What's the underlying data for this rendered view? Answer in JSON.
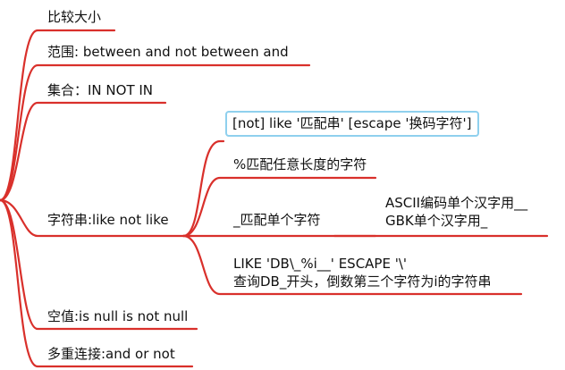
{
  "mindmap": {
    "branches": [
      {
        "label": "比较大小"
      },
      {
        "label": "范围: between and not between and"
      },
      {
        "label": "集合：IN NOT IN"
      },
      {
        "label": "字符串:like not like",
        "children": [
          {
            "label": "[not] like '匹配串' [escape '换码字符']",
            "selected": true
          },
          {
            "label": "%匹配任意长度的字符"
          },
          {
            "label": "_匹配单个字符",
            "children": [
              {
                "lines": [
                  "ASCII编码单个汉字用__",
                  "GBK单个汉字用_"
                ]
              }
            ]
          },
          {
            "lines": [
              "LIKE 'DB\\_%i__' ESCAPE '\\'",
              "查询DB_开头，倒数第三个字符为i的字符串"
            ]
          }
        ]
      },
      {
        "label": "空值:is null is not null"
      },
      {
        "label": "多重连接:and  or  not"
      }
    ]
  },
  "colors": {
    "edge": "#d9302b",
    "selection_border": "#8fd0ee",
    "text": "#111111"
  }
}
